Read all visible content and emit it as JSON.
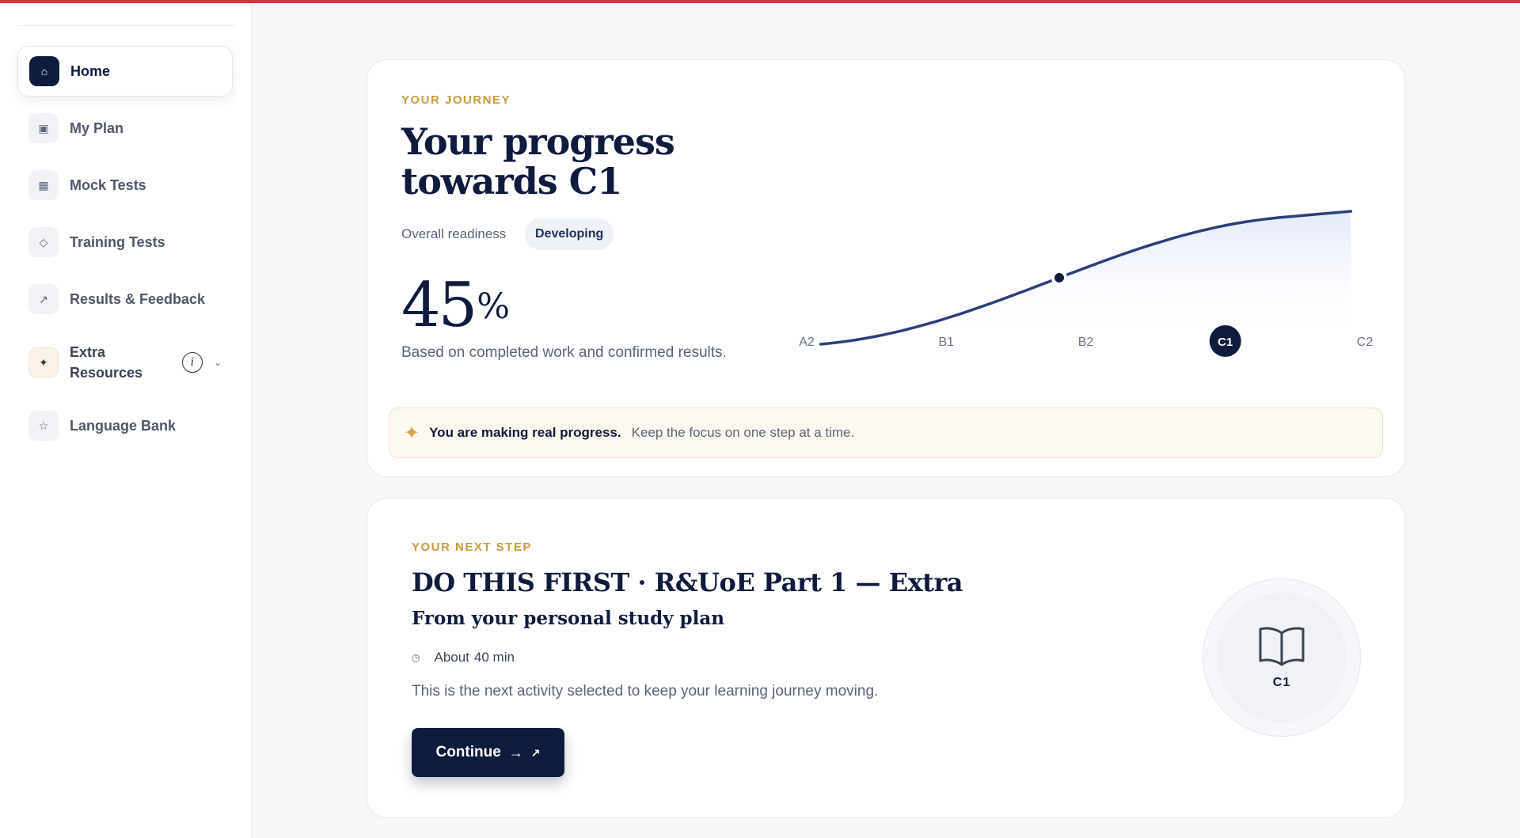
{
  "sidebar": {
    "items": [
      {
        "label": "Home",
        "icon": "home-icon",
        "glyph": "⌂",
        "active": true
      },
      {
        "label": "My Plan",
        "icon": "plan-icon",
        "glyph": "▣"
      },
      {
        "label": "Mock Tests",
        "icon": "grid-icon",
        "glyph": "▦"
      },
      {
        "label": "Training Tests",
        "icon": "diamond-icon",
        "glyph": "◇"
      },
      {
        "label": "Results & Feedback",
        "icon": "arrow-up-right-icon",
        "glyph": "↗"
      },
      {
        "label": "Extra Resources",
        "icon": "sparkle-icon",
        "glyph": "✦",
        "info": "i",
        "chevron": "⌄"
      },
      {
        "label": "Language Bank",
        "icon": "star-icon",
        "glyph": "☆"
      }
    ]
  },
  "journey": {
    "eyebrow": "YOUR JOURNEY",
    "title": "Your progress towards C1",
    "readiness_label": "Overall readiness",
    "readiness_badge": "Developing",
    "percent": "45",
    "percent_sign": "%",
    "based_on": "Based on completed work and confirmed results.",
    "banner_strong": "You are making real progress.",
    "banner_text": "Keep the focus on one step at a time.",
    "banner_icon": "✦"
  },
  "chart_data": {
    "type": "line",
    "categories": [
      "A2",
      "B1",
      "B2",
      "C1",
      "C2"
    ],
    "current_level": "C1",
    "marker_progress": 0.45,
    "curve_start_level": 0.1,
    "curve_end_level": 3.9,
    "line_color": "#2b3f7a",
    "fill_color": "#e9eefb"
  },
  "next_step": {
    "eyebrow": "YOUR NEXT STEP",
    "title": "DO THIS FIRST · R&UoE Part 1 — Extra",
    "subtitle": "From your personal study plan",
    "clock_glyph": "◷",
    "duration_label": "About",
    "duration_value": "40 min",
    "description": "This is the next activity selected to keep your learning journey moving.",
    "button_label": "Continue",
    "button_arrow": "→",
    "button_ext": "↗",
    "level": "C1"
  },
  "colors": {
    "navy": "#0f1b3d",
    "gold": "#c99a3b",
    "accent_red": "#d6343f"
  }
}
